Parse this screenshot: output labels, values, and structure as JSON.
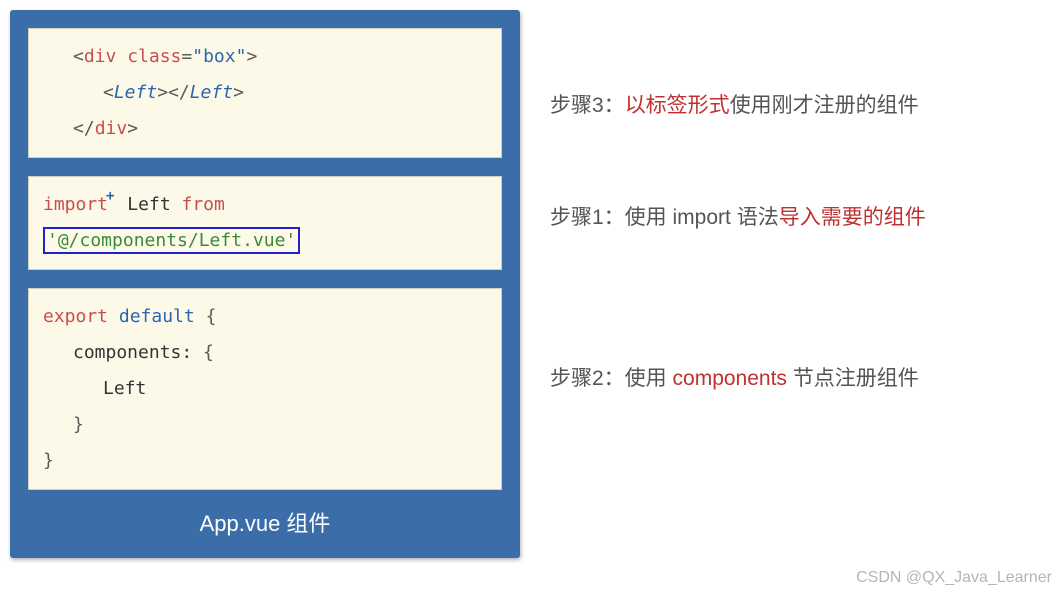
{
  "code": {
    "block1": {
      "l1_open": "<",
      "l1_div": "div",
      "l1_sp": " ",
      "l1_class": "class",
      "l1_eq": "=",
      "l1_q1": "\"",
      "l1_val": "box",
      "l1_q2": "\"",
      "l1_close": ">",
      "l2_open": "<",
      "l2_left": "Left",
      "l2_mid": "></",
      "l2_left2": "Left",
      "l2_close": ">",
      "l3_open": "</",
      "l3_div": "div",
      "l3_close": ">"
    },
    "block2": {
      "import": "import",
      "plus": "+",
      "left": " Left ",
      "from": "from",
      "sp": " ",
      "path": "'@/components/Left.vue'"
    },
    "block3": {
      "export": "export",
      "sp1": " ",
      "default": "default",
      "sp2": " ",
      "brace_open": "{",
      "components": "components:",
      "brace2_open": " {",
      "left": "Left",
      "brace2_close": "}",
      "brace_close": "}"
    }
  },
  "caption": "App.vue 组件",
  "annotations": {
    "a1": {
      "prefix": "步骤3：",
      "hl": "以标签形式",
      "suffix": "使用刚才注册的组件"
    },
    "a2": {
      "prefix": "步骤1：使用 import 语法",
      "hl": "导入需要的组件",
      "suffix": ""
    },
    "a3": {
      "prefix": "步骤2：使用 ",
      "hl": "components",
      "suffix": " 节点注册组件"
    }
  },
  "watermark": "CSDN @QX_Java_Learner"
}
